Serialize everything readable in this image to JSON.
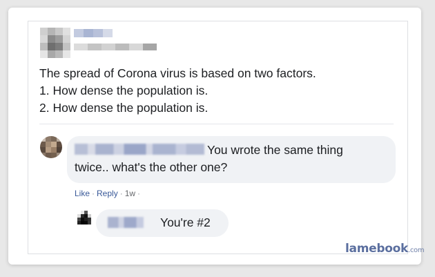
{
  "post": {
    "lines": [
      "The spread of Corona virus is based on two factors.",
      "1. How dense the population is.",
      "2. How dense the population is."
    ]
  },
  "comment": {
    "text": "You wrote the same thing twice.. what's the other one?",
    "actions": {
      "like": "Like",
      "reply": "Reply",
      "time": "1w",
      "dot": "·"
    }
  },
  "reply": {
    "text": "You're #2"
  },
  "watermark": {
    "main": "lamebook",
    "suffix": ".com"
  }
}
